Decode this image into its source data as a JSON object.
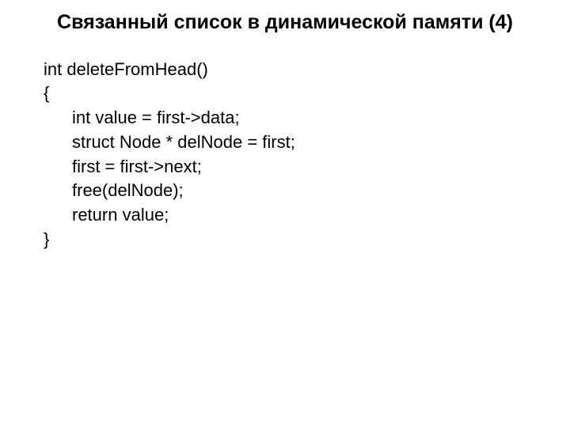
{
  "title": "Связанный список в динамической памяти (4)",
  "code": {
    "line1": "int deleteFromHead()",
    "line2": "{",
    "line3": "int value = first->data;",
    "line4": "struct Node * delNode = first;",
    "line5": "",
    "line6": "first = first->next;",
    "line7": "free(delNode);",
    "line8": "",
    "line9": "return value;",
    "line10": "}"
  }
}
